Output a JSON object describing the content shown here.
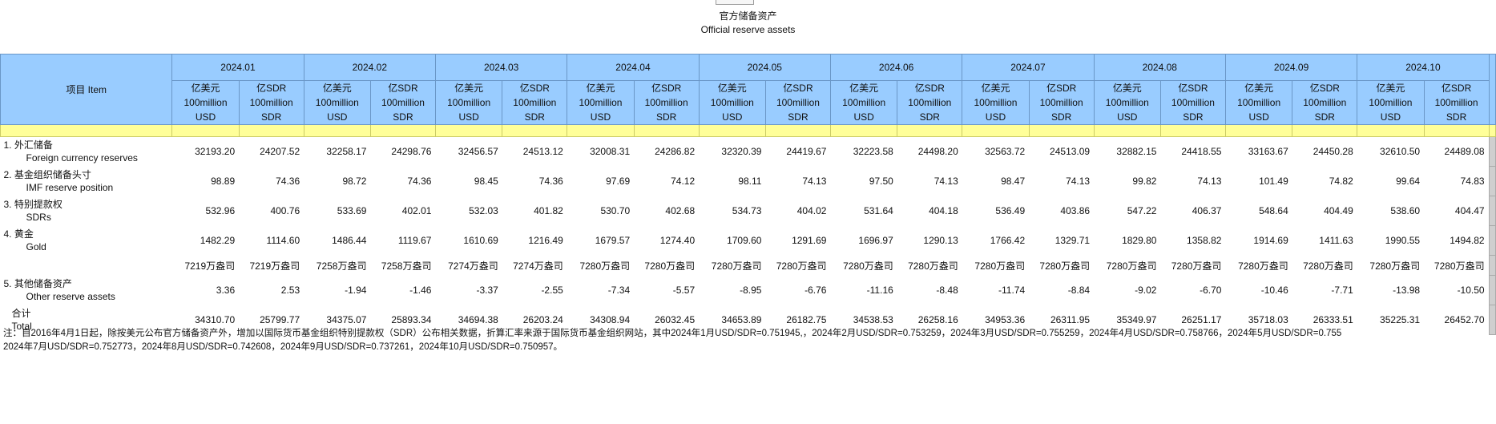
{
  "title_zh": "官方储备资产",
  "title_en": "Official reserve assets",
  "item_header": "项目 Item",
  "periods": [
    "2024.01",
    "2024.02",
    "2024.03",
    "2024.04",
    "2024.05",
    "2024.06",
    "2024.07",
    "2024.08",
    "2024.09",
    "2024.10"
  ],
  "unit_usd": [
    "亿美元",
    "100million",
    "USD"
  ],
  "unit_sdr": [
    "亿SDR",
    "100million",
    "SDR"
  ],
  "rows": [
    {
      "zh": "1. 外汇储备",
      "en": "Foreign currency reserves",
      "values": [
        "32193.20",
        "24207.52",
        "32258.17",
        "24298.76",
        "32456.57",
        "24513.12",
        "32008.31",
        "24286.82",
        "32320.39",
        "24419.67",
        "32223.58",
        "24498.20",
        "32563.72",
        "24513.09",
        "32882.15",
        "24418.55",
        "33163.67",
        "24450.28",
        "32610.50",
        "24489.08"
      ]
    },
    {
      "zh": "2. 基金组织储备头寸",
      "en": "IMF reserve position",
      "values": [
        "98.89",
        "74.36",
        "98.72",
        "74.36",
        "98.45",
        "74.36",
        "97.69",
        "74.12",
        "98.11",
        "74.13",
        "97.50",
        "74.13",
        "98.47",
        "74.13",
        "99.82",
        "74.13",
        "101.49",
        "74.82",
        "99.64",
        "74.83"
      ]
    },
    {
      "zh": "3. 特别提款权",
      "en": "SDRs",
      "values": [
        "532.96",
        "400.76",
        "533.69",
        "402.01",
        "532.03",
        "401.82",
        "530.70",
        "402.68",
        "534.73",
        "404.02",
        "531.64",
        "404.18",
        "536.49",
        "403.86",
        "547.22",
        "406.37",
        "548.64",
        "404.49",
        "538.60",
        "404.47"
      ]
    },
    {
      "zh": "4. 黄金",
      "en": "Gold",
      "values": [
        "1482.29",
        "1114.60",
        "1486.44",
        "1119.67",
        "1610.69",
        "1216.49",
        "1679.57",
        "1274.40",
        "1709.60",
        "1291.69",
        "1696.97",
        "1290.13",
        "1766.42",
        "1329.71",
        "1829.80",
        "1358.82",
        "1914.69",
        "1411.63",
        "1990.55",
        "1494.82"
      ]
    },
    {
      "zh": "",
      "en": "",
      "values": [
        "7219万盎司",
        "7219万盎司",
        "7258万盎司",
        "7258万盎司",
        "7274万盎司",
        "7274万盎司",
        "7280万盎司",
        "7280万盎司",
        "7280万盎司",
        "7280万盎司",
        "7280万盎司",
        "7280万盎司",
        "7280万盎司",
        "7280万盎司",
        "7280万盎司",
        "7280万盎司",
        "7280万盎司",
        "7280万盎司",
        "7280万盎司",
        "7280万盎司"
      ]
    },
    {
      "zh": "5. 其他储备资产",
      "en": "Other reserve assets",
      "values": [
        "3.36",
        "2.53",
        "-1.94",
        "-1.46",
        "-3.37",
        "-2.55",
        "-7.34",
        "-5.57",
        "-8.95",
        "-6.76",
        "-11.16",
        "-8.48",
        "-11.74",
        "-8.84",
        "-9.02",
        "-6.70",
        "-10.46",
        "-7.71",
        "-13.98",
        "-10.50"
      ]
    },
    {
      "zh": "合计",
      "en": "Total",
      "values": [
        "34310.70",
        "25799.77",
        "34375.07",
        "25893.34",
        "34694.38",
        "26203.24",
        "34308.94",
        "26032.45",
        "34653.89",
        "26182.75",
        "34538.53",
        "26258.16",
        "34953.36",
        "26311.95",
        "35349.97",
        "26251.17",
        "35718.03",
        "26333.51",
        "35225.31",
        "26452.70"
      ]
    }
  ],
  "note_line1": "注：自2016年4月1日起，除按美元公布官方储备资产外，增加以国际货币基金组织特别提款权（SDR）公布相关数据，折算汇率来源于国际货币基金组织网站，其中2024年1月USD/SDR=0.751945,，2024年2月USD/SDR=0.753259，2024年3月USD/SDR=0.755259，2024年4月USD/SDR=0.758766，2024年5月USD/SDR=0.755",
  "note_line2": "2024年7月USD/SDR=0.752773，2024年8月USD/SDR=0.742608，2024年9月USD/SDR=0.737261，2024年10月USD/SDR=0.750957。"
}
